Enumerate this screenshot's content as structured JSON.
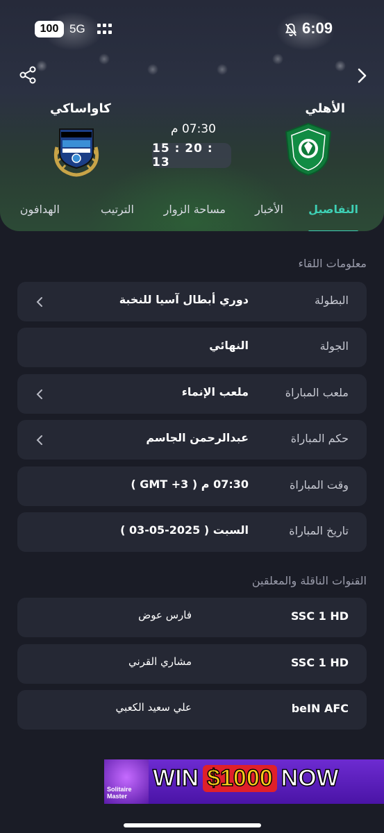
{
  "status_bar": {
    "battery": "100",
    "network": "5G",
    "time": "6:09"
  },
  "match": {
    "home_team": "الأهلي",
    "away_team": "كاواساكي",
    "kickoff": "07:30 م",
    "countdown": "15 : 20 : 13"
  },
  "tabs": [
    {
      "label": "التفاصيل",
      "active": true
    },
    {
      "label": "الأخبار",
      "active": false
    },
    {
      "label": "مساحة الزوار",
      "active": false
    },
    {
      "label": "الترتيب",
      "active": false
    },
    {
      "label": "الهدافون",
      "active": false
    }
  ],
  "match_info": {
    "title": "معلومات اللقاء",
    "rows": [
      {
        "label": "البطولة",
        "value": "دوري أبطال آسيا للنخبة",
        "has_chevron": true
      },
      {
        "label": "الجولة",
        "value": "النهائي",
        "has_chevron": false
      },
      {
        "label": "ملعب المباراة",
        "value": "ملعب الإنماء",
        "has_chevron": true
      },
      {
        "label": "حكم المباراة",
        "value": "عبدالرحمن الجاسم",
        "has_chevron": true
      },
      {
        "label": "وقت المباراة",
        "value": "07:30 م ( GMT +3 )",
        "has_chevron": false
      },
      {
        "label": "تاريخ المباراة",
        "value": "السبت ( 2025-05-03 )",
        "has_chevron": false
      }
    ]
  },
  "broadcast": {
    "title": "القنوات الناقلة والمعلقين",
    "rows": [
      {
        "channel": "SSC 1 HD",
        "commentator": "فارس عوض"
      },
      {
        "channel": "SSC 1 HD",
        "commentator": "مشاري القرني"
      },
      {
        "channel": "beIN AFC",
        "commentator": "علي سعيد الكعبي"
      }
    ]
  },
  "ad": {
    "logo_text": "Solitaire Master",
    "win": "WIN",
    "amount": "$1000",
    "now": "NOW"
  },
  "colors": {
    "accent": "#3ed0b5",
    "background": "#1a1c26",
    "card": "#252834"
  }
}
